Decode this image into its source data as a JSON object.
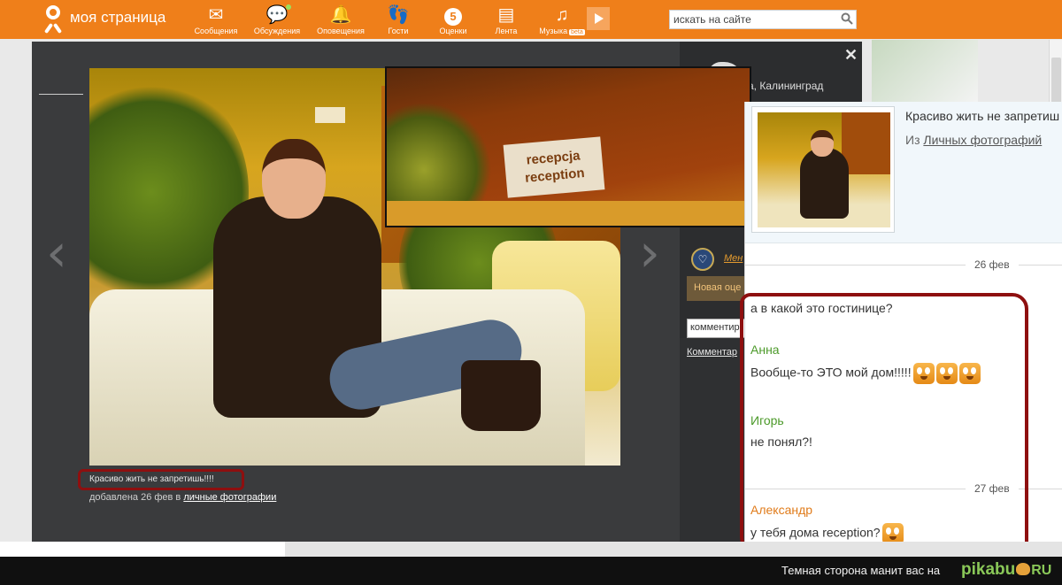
{
  "topbar": {
    "site_title": "моя страница",
    "nav": [
      {
        "label": "Сообщения",
        "icon": "envelope-icon"
      },
      {
        "label": "Обсуждения",
        "icon": "chat-bubbles-icon"
      },
      {
        "label": "Оповещения",
        "icon": "bell-icon"
      },
      {
        "label": "Гости",
        "icon": "footprints-icon"
      },
      {
        "label": "Оценки",
        "icon": "rating-five-icon",
        "badge": "5"
      },
      {
        "label": "Лента",
        "icon": "feed-icon"
      },
      {
        "label": "Музыка",
        "icon": "music-note-icon",
        "tag": "beta"
      }
    ],
    "search_placeholder": "искать на сайте"
  },
  "viewer": {
    "location": "а, Калининград",
    "zoom_sign": [
      "recepcja",
      "reception"
    ],
    "caption": "Красиво жить не запретишь!!!!",
    "added_prefix": "добавлена 26 фев в",
    "album_link": "личные фотографии",
    "menu_link": "Мен",
    "new_rating": "Новая оце",
    "comment_placeholder": "комментир",
    "comments_link": "Комментар"
  },
  "notification": {
    "title": "Красиво жить не запретиш",
    "from_prefix": "Из",
    "from_link": "Личных фотографий",
    "messages": [
      {
        "date": "26 фев"
      },
      {
        "text": "а в какой это гостинице?"
      },
      {
        "author": "Анна",
        "author_color": "#4c9a2a",
        "text": "Вообще-то ЭТО мой дом!!!!!",
        "smileys": 3
      },
      {
        "author": "Игорь",
        "author_color": "#4c9a2a",
        "text": "не понял?!"
      },
      {
        "date": "27 фев"
      },
      {
        "author": "Александр",
        "author_color": "#e07b1a",
        "text": "у тебя дома reception?",
        "smileys": 1
      }
    ]
  },
  "footer": {
    "slogan": "Темная сторона манит вас на",
    "brand": "pikabu",
    "brand_tld": "RU"
  },
  "colors": {
    "topbar": "#ef7f1a",
    "highlight_frame": "#8e0f0f",
    "green_author": "#4c9a2a",
    "orange_author": "#e07b1a"
  }
}
